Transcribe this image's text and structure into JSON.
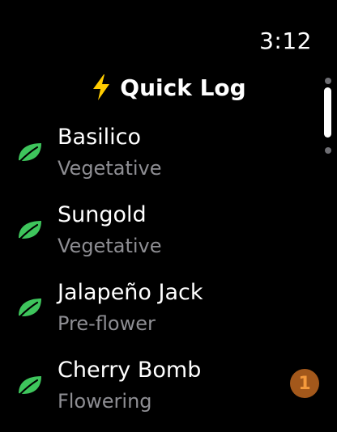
{
  "status": {
    "time": "3:12"
  },
  "header": {
    "title": "Quick Log",
    "icon": "bolt-icon"
  },
  "colors": {
    "accent_bolt": "#ffcc00",
    "leaf": "#3ec55c",
    "secondary_text": "#8e8e93",
    "badge_bg": "#a3581b",
    "badge_text": "#f59a3c"
  },
  "plants": [
    {
      "name": "Basilico",
      "stage": "Vegetative",
      "icon": "leaf-icon"
    },
    {
      "name": "Sungold",
      "stage": "Vegetative",
      "icon": "leaf-icon"
    },
    {
      "name": "Jalapeño Jack",
      "stage": "Pre-flower",
      "icon": "leaf-icon"
    },
    {
      "name": "Cherry Bomb",
      "stage": "Flowering",
      "icon": "leaf-icon"
    }
  ],
  "badge": {
    "count": "1"
  }
}
